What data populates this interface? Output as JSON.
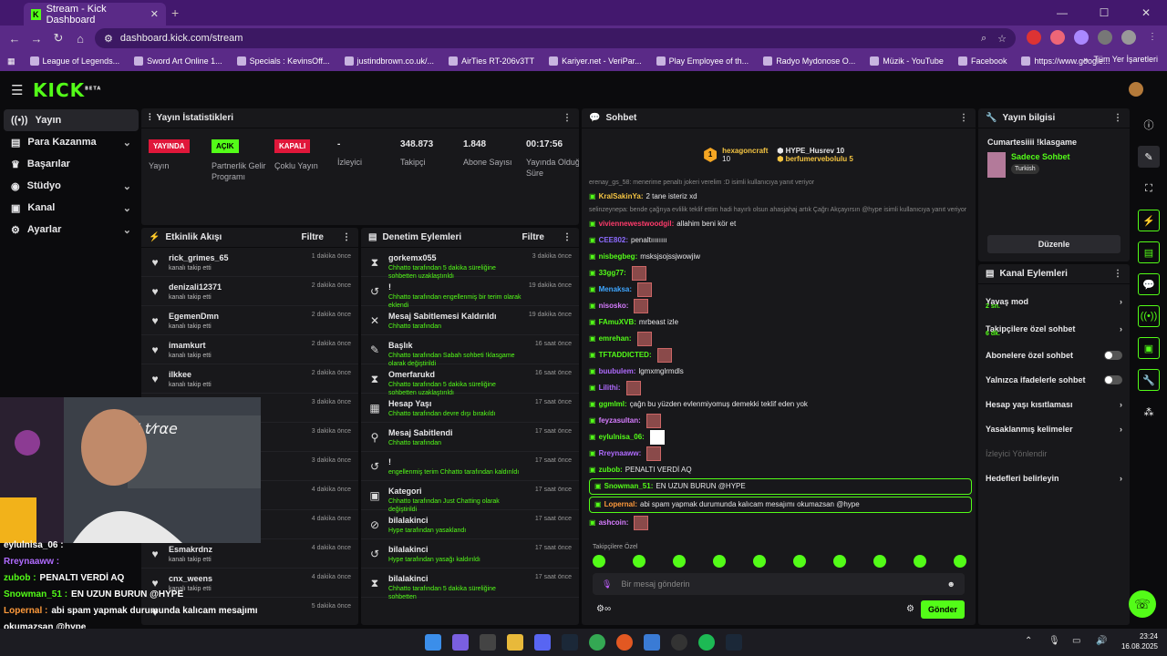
{
  "browser": {
    "tab_title": "Stream - Kick Dashboard",
    "url": "dashboard.kick.com/stream",
    "bookmarks": [
      "League of Legends...",
      "Sword Art Online 1...",
      "Specials : KevinsOff...",
      "justindbrown.co.uk/...",
      "AirTies RT-206v3TT",
      "Kariyer.net - VeriPar...",
      "Play Employee of th...",
      "Radyo Mydonose O...",
      "Müzik - YouTube",
      "Facebook",
      "https://www.google..."
    ],
    "bookmarks_folder": "Tüm Yer İşaretleri"
  },
  "sidebar": {
    "items": [
      {
        "label": "Yayın"
      },
      {
        "label": "Para Kazanma"
      },
      {
        "label": "Başarılar"
      },
      {
        "label": "Stüdyo"
      },
      {
        "label": "Kanal"
      },
      {
        "label": "Ayarlar"
      }
    ]
  },
  "stats": {
    "title": "Yayın İstatistikleri",
    "items": [
      {
        "badge": "YAYINDA",
        "label": "Yayın"
      },
      {
        "badge": "AÇIK",
        "label": "Partnerlik Gelir Programı"
      },
      {
        "badge": "KAPALI",
        "label": "Çoklu Yayın"
      },
      {
        "value": "-",
        "label": "İzleyici"
      },
      {
        "value": "348.873",
        "label": "Takipçi"
      },
      {
        "value": "1.848",
        "label": "Abone Sayısı"
      },
      {
        "value": "00:17:56",
        "label": "Yayında Olduğu Süre"
      }
    ]
  },
  "activity": {
    "title": "Etkinlik Akışı",
    "filter": "Filtre",
    "items": [
      {
        "name": "rick_grimes_65",
        "sub": "kanalı takip etti",
        "time": "1 dakika önce"
      },
      {
        "name": "denizali12371",
        "sub": "kanalı takip etti",
        "time": "2 dakika önce"
      },
      {
        "name": "EgemenDmn",
        "sub": "kanalı takip etti",
        "time": "2 dakika önce"
      },
      {
        "name": "imamkurt",
        "sub": "kanalı takip etti",
        "time": "2 dakika önce"
      },
      {
        "name": "ilkkee",
        "sub": "kanalı takip etti",
        "time": "2 dakika önce"
      },
      {
        "name": "",
        "sub": "",
        "time": "3 dakika önce"
      },
      {
        "name": "",
        "sub": "",
        "time": "3 dakika önce"
      },
      {
        "name": "",
        "sub": "",
        "time": "3 dakika önce"
      },
      {
        "name": "",
        "sub": "",
        "time": "4 dakika önce"
      },
      {
        "name": "",
        "sub": "",
        "time": "4 dakika önce"
      },
      {
        "name": "Esmakrdnz",
        "sub": "kanalı takip etti",
        "time": "4 dakika önce"
      },
      {
        "name": "cnx_weens",
        "sub": "kanalı takip etti",
        "time": "4 dakika önce"
      },
      {
        "name": "",
        "sub": "",
        "time": "5 dakika önce"
      }
    ]
  },
  "moderation": {
    "title": "Denetim Eylemleri",
    "filter": "Filtre",
    "items": [
      {
        "icon": "hourglass-icon",
        "glyph": "⧗",
        "name": "gorkemx055",
        "sub": "Chhatto tarafından 5 dakika süreliğine sohbetten uzaklaştırıldı",
        "time": "3 dakika önce"
      },
      {
        "icon": "undo-icon",
        "glyph": "↺",
        "name": "!",
        "sub": "Chhatto tarafından engellenmiş bir terim olarak eklendi",
        "time": "19 dakika önce"
      },
      {
        "icon": "unpin-icon",
        "glyph": "✕",
        "name": "Mesaj Sabitlemesi Kaldırıldı",
        "sub": "Chhatto tarafından",
        "time": "19 dakika önce"
      },
      {
        "icon": "title-icon",
        "glyph": "✎",
        "name": "Başlık",
        "sub": "Chhatto tarafından Sabah sohbeti !klasgame olarak değiştirildi",
        "time": "16 saat önce"
      },
      {
        "icon": "hourglass-icon",
        "glyph": "⧗",
        "name": "Omerfarukd",
        "sub": "Chhatto tarafından 5 dakika süreliğine sohbetten uzaklaştırıldı",
        "time": "16 saat önce"
      },
      {
        "icon": "calendar-icon",
        "glyph": "▦",
        "name": "Hesap Yaşı",
        "sub": "Chhatto tarafından devre dışı bırakıldı",
        "time": "17 saat önce"
      },
      {
        "icon": "pin-icon",
        "glyph": "⚲",
        "name": "Mesaj Sabitlendi",
        "sub": "Chhatto tarafından",
        "time": "17 saat önce"
      },
      {
        "icon": "undo-icon",
        "glyph": "↺",
        "name": "!",
        "sub": "engellenmiş terim Chhatto tarafından kaldırıldı",
        "time": "17 saat önce"
      },
      {
        "icon": "category-icon",
        "glyph": "▣",
        "name": "Kategori",
        "sub": "Chhatto tarafından Just Chatting olarak değiştirildi",
        "time": "17 saat önce"
      },
      {
        "icon": "ban-icon",
        "glyph": "⊘",
        "name": "bilalakinci",
        "sub": "Hype tarafından yasaklandı",
        "time": "17 saat önce"
      },
      {
        "icon": "undo-icon",
        "glyph": "↺",
        "name": "bilalakinci",
        "sub": "Hype tarafından yasağı kaldırıldı",
        "time": "17 saat önce"
      },
      {
        "icon": "hourglass-icon",
        "glyph": "⧗",
        "name": "bilalakinci",
        "sub": "Chhatto tarafından 5 dakika süreliğine sohbetten",
        "time": "17 saat önce"
      }
    ]
  },
  "chat": {
    "title": "Sohbet",
    "pinned": [
      {
        "name": "hexagoncraft",
        "count": "10"
      },
      {
        "name": "HYPE_Husrev",
        "count": "10"
      },
      {
        "name": "berfumervebolulu",
        "count": "5"
      }
    ],
    "messages": [
      {
        "sys": true,
        "text": "erenay_gs_58: menerime penaltı jokeri verelim :D isimli kullanıcıya yanıt veriyor"
      },
      {
        "user": "KralSakinYa:",
        "color": "#f5c542",
        "text": "2 tane isteriz xd"
      },
      {
        "sys": true,
        "text": "selinzeynepa: bende çağrıya evlilik teklif ettim hadi hayırlı olsun ahasjahaj artık Çağrı Akçayırsın @hype isimli kullanıcıya yanıt veriyor"
      },
      {
        "user": "viviennewestwoodgil:",
        "color": "#ff3b6b",
        "text": "allahim beni kör et"
      },
      {
        "user": "CEE802:",
        "color": "#8c6bff",
        "text": "penaltıııııııı"
      },
      {
        "user": "nisbegbeg:",
        "color": "#53fc18",
        "text": "msksjsojssjwowjiw"
      },
      {
        "user": "33gg77:",
        "color": "#53fc18",
        "text": "",
        "emote": true
      },
      {
        "user": "Menaksa:",
        "color": "#3ea6ff",
        "text": "",
        "emote": true
      },
      {
        "user": "nisosko:",
        "color": "#d67cff",
        "text": "",
        "emote": true
      },
      {
        "user": "FAmuXVB:",
        "color": "#53fc18",
        "text": "mrbeast izle"
      },
      {
        "user": "emrehan:",
        "color": "#53fc18",
        "text": "",
        "emote": true
      },
      {
        "user": "TFTADDICTED:",
        "color": "#53fc18",
        "text": "",
        "emote": true
      },
      {
        "user": "buubulem:",
        "color": "#b06bff",
        "text": "lgmxmglrmdls"
      },
      {
        "user": "Lilithi:",
        "color": "#b06bff",
        "text": "",
        "emote": true
      },
      {
        "user": "ggmlml:",
        "color": "#53fc18",
        "text": "çağn bu yüzden evlenmiyomuş demekki teklif eden yok"
      },
      {
        "user": "feyzasultan:",
        "color": "#d67cff",
        "text": "",
        "emote": true
      },
      {
        "user": "eylulnisa_06:",
        "color": "#53fc18",
        "text": ""
      },
      {
        "user": "Rreynaaww:",
        "color": "#b06bff",
        "text": "",
        "emote": true
      },
      {
        "user": "zubob:",
        "color": "#53fc18",
        "text": "PENALTI VERDİ AQ"
      },
      {
        "user": "Snowman_51:",
        "color": "#53fc18",
        "text": "EN UZUN BURUN @HYPE",
        "hl": true
      },
      {
        "user": "Lopernal:",
        "color": "#ff9a3b",
        "text": "abi spam yapmak durumunda kalıcam mesajımı okumazsan @hype",
        "hl": true
      },
      {
        "user": "ashcoin:",
        "color": "#d67cff",
        "text": "",
        "emote": true
      }
    ],
    "followers_only": "Takipçilere Özel",
    "placeholder": "Bir mesaj gönderin",
    "send": "Gönder"
  },
  "info": {
    "title": "Yayın bilgisi",
    "stream_title": "Cumartesiiii !klasgame",
    "category": "Sadece Sohbet",
    "language": "Turkish",
    "edit": "Düzenle"
  },
  "actions": {
    "title": "Kanal Eylemleri",
    "items": [
      {
        "label": "Yavaş mod",
        "sub": "2 sn.",
        "type": "chev"
      },
      {
        "label": "Takipçilere özel sohbet",
        "sub": "6 dk.",
        "type": "chev"
      },
      {
        "label": "Abonelere özel sohbet",
        "sub": "",
        "type": "toggle"
      },
      {
        "label": "Yalnızca ifadelerle sohbet",
        "sub": "",
        "type": "toggle"
      },
      {
        "label": "Hesap yaşı kısıtlaması",
        "sub": "",
        "type": "chev"
      },
      {
        "label": "Yasaklanmış kelimeler",
        "sub": "",
        "type": "chev"
      },
      {
        "label": "İzleyici Yönlendir",
        "sub": "",
        "type": "dim"
      },
      {
        "label": "Hedefleri belirleyin",
        "sub": "",
        "type": "chev"
      }
    ]
  },
  "overlay": [
    {
      "user": "eylulnisa_06 :",
      "color": "#fff",
      "text": ""
    },
    {
      "user": "Rreynaaww :",
      "color": "#b06bff",
      "text": ""
    },
    {
      "user": "zubob :",
      "color": "#53fc18",
      "text": "PENALTI VERDİ AQ"
    },
    {
      "user": "Snowman_51 :",
      "color": "#53fc18",
      "text": "EN UZUN BURUN @HYPE"
    },
    {
      "user": "Lopernal :",
      "color": "#ff9a3b",
      "text": "abi spam yapmak durumunda kalıcam mesajımı okumazsan @hype"
    }
  ],
  "clock": {
    "time": "23:24",
    "date": "16.08.2025"
  }
}
